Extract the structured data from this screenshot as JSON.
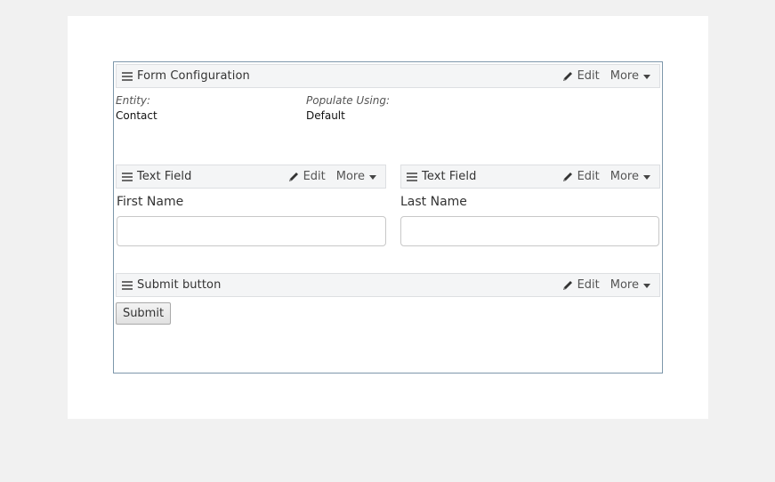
{
  "form_config": {
    "title": "Form Configuration",
    "edit_label": "Edit",
    "more_label": "More",
    "entity_label": "Entity:",
    "entity_value": "Contact",
    "populate_label": "Populate Using:",
    "populate_value": "Default"
  },
  "fields": [
    {
      "title": "Text Field",
      "edit_label": "Edit",
      "more_label": "More",
      "label": "First Name",
      "value": ""
    },
    {
      "title": "Text Field",
      "edit_label": "Edit",
      "more_label": "More",
      "label": "Last Name",
      "value": ""
    }
  ],
  "submit_block": {
    "title": "Submit button",
    "edit_label": "Edit",
    "more_label": "More",
    "button_label": "Submit"
  }
}
